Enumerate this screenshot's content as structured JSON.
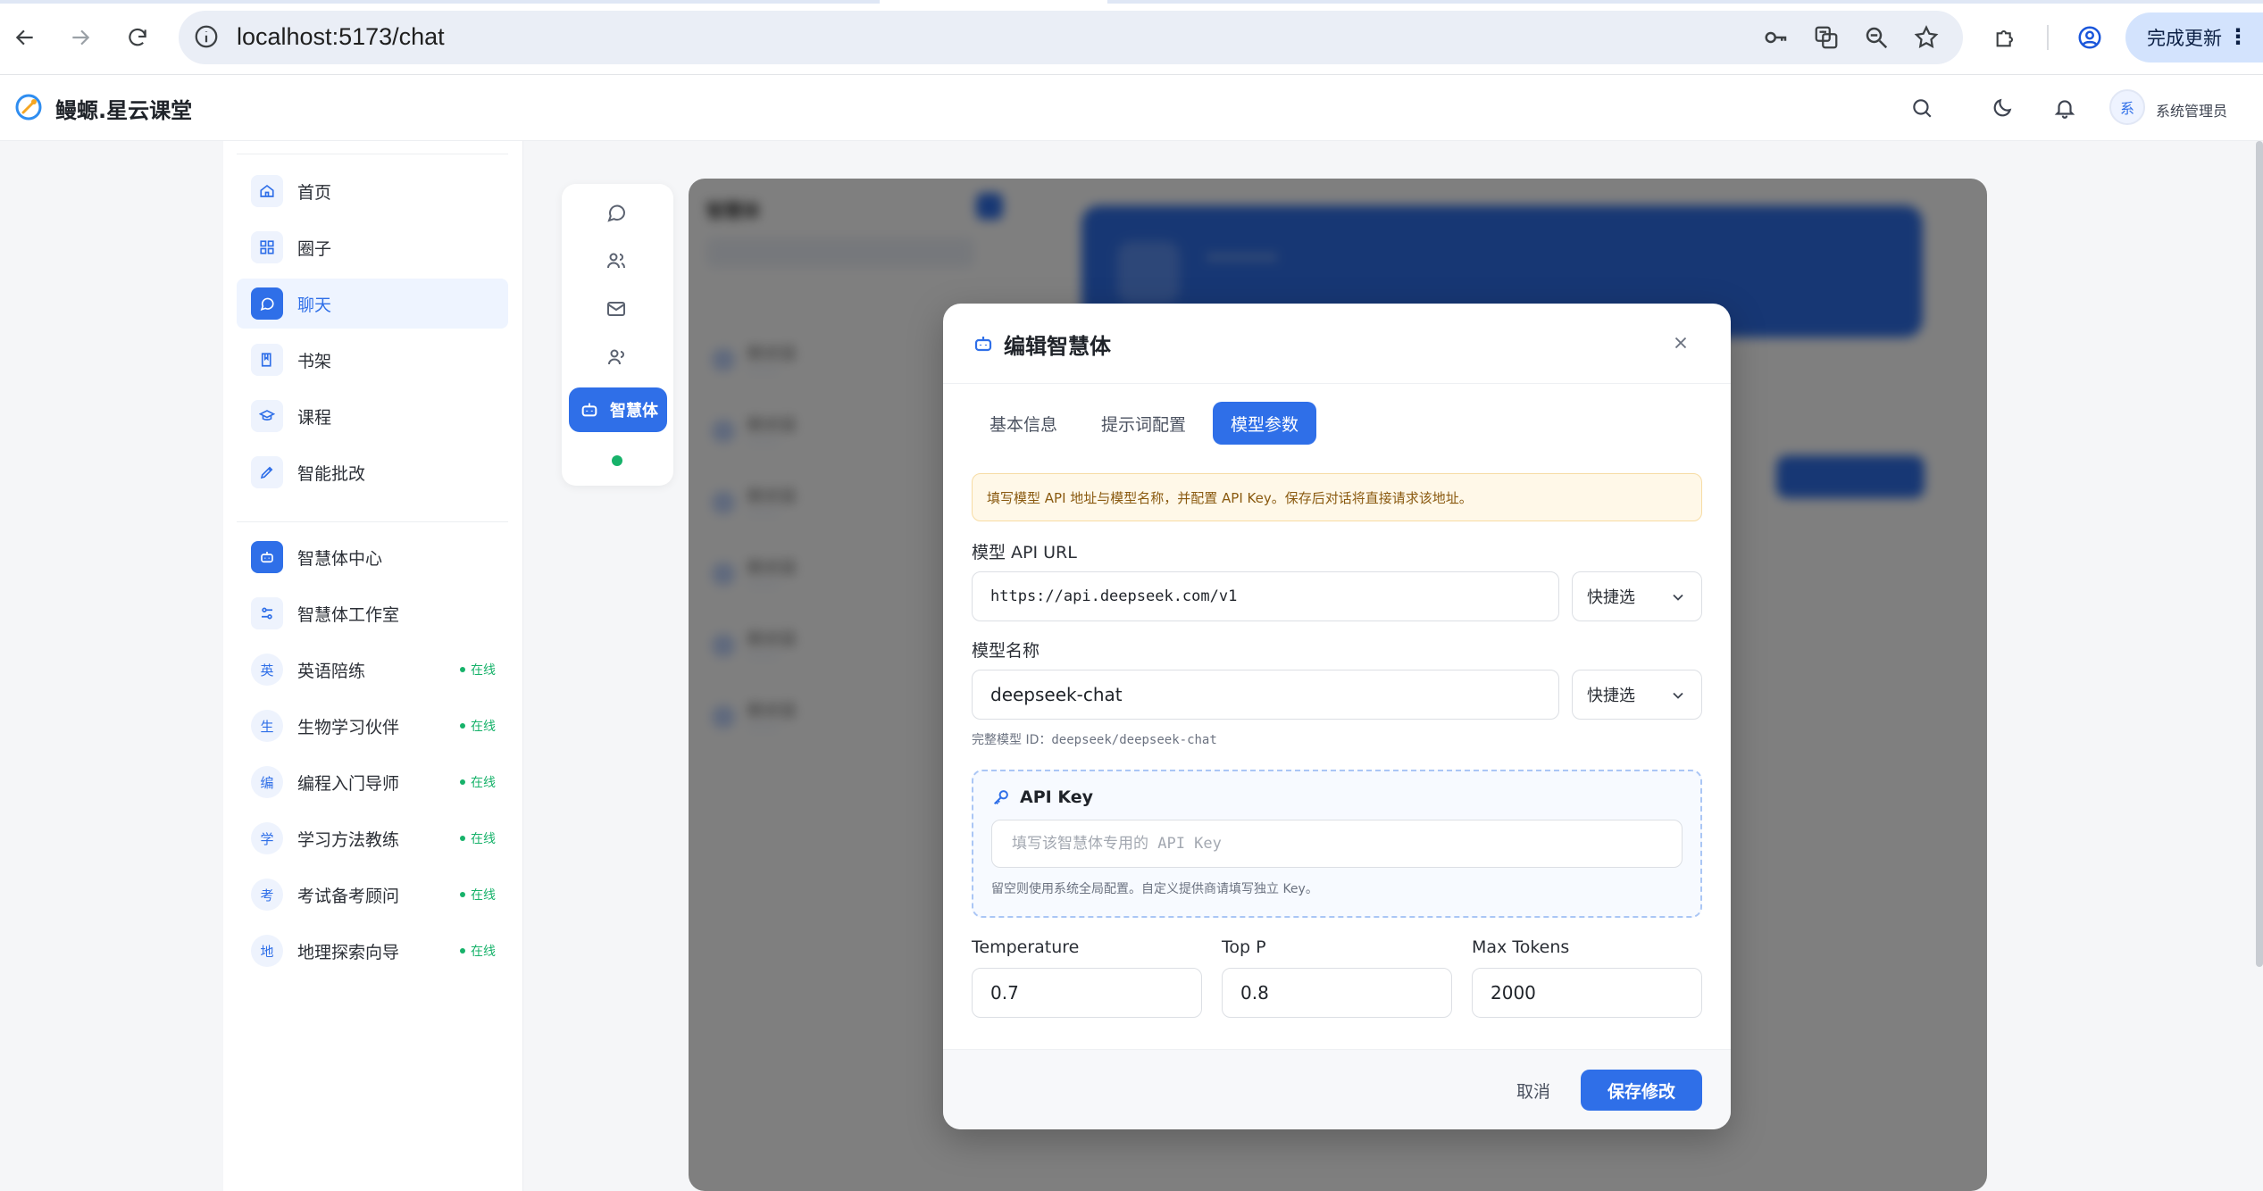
{
  "browser": {
    "url": "localhost:5173/chat",
    "update_label": "完成更新"
  },
  "app": {
    "brand": "鳗螈.星云课堂",
    "user": {
      "avatar_text": "系",
      "name": "系统管理员"
    }
  },
  "sidebar": {
    "nav": [
      {
        "label": "首页",
        "icon": "home-icon"
      },
      {
        "label": "圈子",
        "icon": "grid-icon"
      },
      {
        "label": "聊天",
        "icon": "chat-icon",
        "active": true
      },
      {
        "label": "书架",
        "icon": "book-icon"
      },
      {
        "label": "课程",
        "icon": "graduation-cap-icon"
      },
      {
        "label": "智能批改",
        "icon": "pen-icon"
      }
    ],
    "agents_center": "智慧体中心",
    "agents_studio": "智慧体工作室",
    "agents": [
      {
        "avatar": "英",
        "label": "英语陪练",
        "status": "在线"
      },
      {
        "avatar": "生",
        "label": "生物学习伙伴",
        "status": "在线"
      },
      {
        "avatar": "编",
        "label": "编程入门导师",
        "status": "在线"
      },
      {
        "avatar": "学",
        "label": "学习方法教练",
        "status": "在线"
      },
      {
        "avatar": "考",
        "label": "考试备考顾问",
        "status": "在线"
      },
      {
        "avatar": "地",
        "label": "地理探索向导",
        "status": "在线"
      }
    ]
  },
  "rail": {
    "active_label": "智慧体"
  },
  "modal": {
    "title": "编辑智慧体",
    "tabs": [
      "基本信息",
      "提示词配置",
      "模型参数"
    ],
    "active_tab": "模型参数",
    "notice": "填写模型 API 地址与模型名称，并配置 API Key。保存后对话将直接请求该地址。",
    "api_url": {
      "label": "模型 API URL",
      "value": "https://api.deepseek.com/v1",
      "quick_select": "快捷选"
    },
    "model_name": {
      "label": "模型名称",
      "value": "deepseek-chat",
      "quick_select": "快捷选",
      "full_id_label": "完整模型 ID：",
      "full_id_value": "deepseek/deepseek-chat"
    },
    "api_key": {
      "title": "API Key",
      "placeholder": "填写该智慧体专用的 API Key",
      "hint": "留空则使用系统全局配置。自定义提供商请填写独立 Key。"
    },
    "params": {
      "temperature": {
        "label": "Temperature",
        "value": "0.7"
      },
      "top_p": {
        "label": "Top P",
        "value": "0.8"
      },
      "max_tokens": {
        "label": "Max Tokens",
        "value": "2000"
      }
    },
    "cancel_label": "取消",
    "save_label": "保存修改"
  },
  "colors": {
    "primary": "#2f6fe8",
    "online": "#17b26a",
    "notice_bg": "#fff8e8"
  }
}
